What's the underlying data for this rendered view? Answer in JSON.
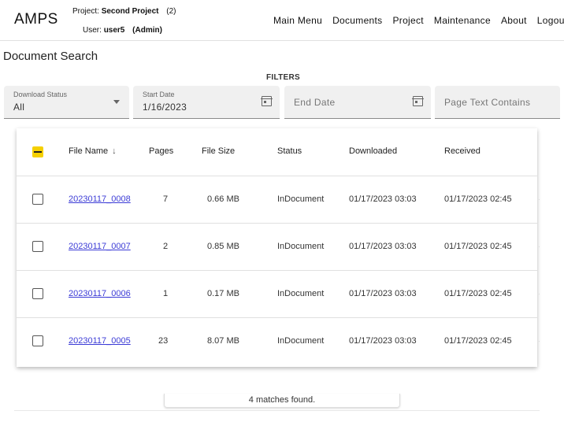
{
  "app": {
    "logo": "AMPS",
    "project_label": "Project:",
    "project_name": "Second Project",
    "project_count": "(2)",
    "user_label": "User:",
    "user_name": "user5",
    "user_role": "(Admin)"
  },
  "nav": [
    "Main Menu",
    "Documents",
    "Project",
    "Maintenance",
    "About",
    "Logout"
  ],
  "page": {
    "title": "Document Search",
    "filters_label": "FILTERS"
  },
  "filters": {
    "download_status": {
      "label": "Download Status",
      "value": "All"
    },
    "start_date": {
      "label": "Start Date",
      "value": "1/16/2023"
    },
    "end_date": {
      "placeholder": "End Date"
    },
    "page_text": {
      "placeholder": "Page Text Contains"
    }
  },
  "table": {
    "headers": [
      "File Name",
      "Pages",
      "File Size",
      "Status",
      "Downloaded",
      "Received"
    ],
    "sort_icon": "arrow-down-icon",
    "rows": [
      {
        "file": "20230117_0008",
        "pages": "7",
        "size": "0.66 MB",
        "status": "InDocument",
        "downloaded": "01/17/2023 03:03",
        "received": "01/17/2023 02:45"
      },
      {
        "file": "20230117_0007",
        "pages": "2",
        "size": "0.85 MB",
        "status": "InDocument",
        "downloaded": "01/17/2023 03:03",
        "received": "01/17/2023 02:45"
      },
      {
        "file": "20230117_0006",
        "pages": "1",
        "size": "0.17 MB",
        "status": "InDocument",
        "downloaded": "01/17/2023 03:03",
        "received": "01/17/2023 02:45"
      },
      {
        "file": "20230117_0005",
        "pages": "23",
        "size": "8.07 MB",
        "status": "InDocument",
        "downloaded": "01/17/2023 03:03",
        "received": "01/17/2023 02:45"
      }
    ]
  },
  "footer": {
    "matches": "4 matches found."
  },
  "colors": {
    "accent": "#f5d000",
    "link": "#3b3bd6"
  }
}
